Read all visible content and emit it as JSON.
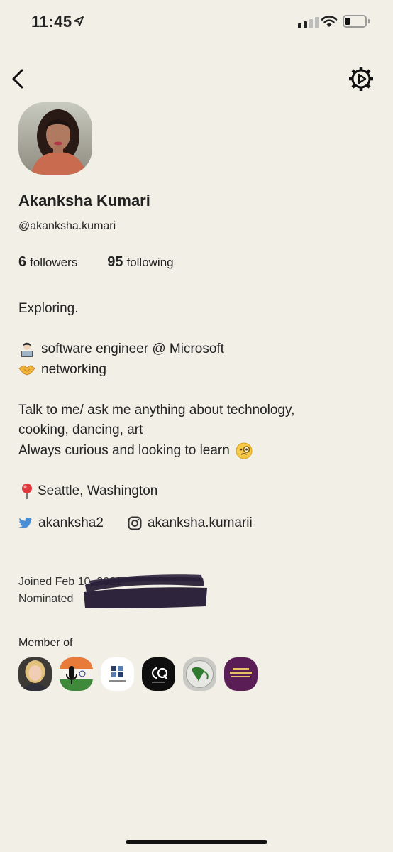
{
  "status_bar": {
    "time": "11:45",
    "battery_level": 0.2
  },
  "nav": {
    "back_icon": "chevron-left-icon",
    "settings_icon": "gear-icon"
  },
  "profile": {
    "name": "Akanksha Kumari",
    "handle": "@akanksha.kumari",
    "followers_count": "6",
    "followers_label": "followers",
    "following_count": "95",
    "following_label": "following"
  },
  "bio": {
    "line1": "Exploring.",
    "line2": "software engineer @ Microsoft",
    "line2_icon": "technologist-emoji",
    "line3": "networking",
    "line3_icon": "handshake-emoji",
    "line4": "Talk to me/ ask me anything about technology,",
    "line5": "cooking, dancing, art",
    "line6": "Always curious and looking to learn",
    "line6_icon": "monocle-face-emoji",
    "line7": "Seattle, Washington",
    "line7_icon": "round-pushpin-emoji"
  },
  "socials": {
    "twitter": "akanksha2",
    "twitter_icon": "twitter-icon",
    "instagram": "akanksha.kumarii",
    "instagram_icon": "instagram-icon"
  },
  "joined": {
    "joined_text": "Joined Feb 10, 2021",
    "nominated_text": "Nominated"
  },
  "member_of": {
    "title": "Member of",
    "clubs": [
      "club-avatar-1",
      "club-avatar-2",
      "club-avatar-3",
      "club-avatar-4",
      "club-avatar-5",
      "club-avatar-6"
    ]
  },
  "colors": {
    "background": "#f1efe6",
    "text": "#232323",
    "twitter_blue": "#4a8ed6"
  }
}
